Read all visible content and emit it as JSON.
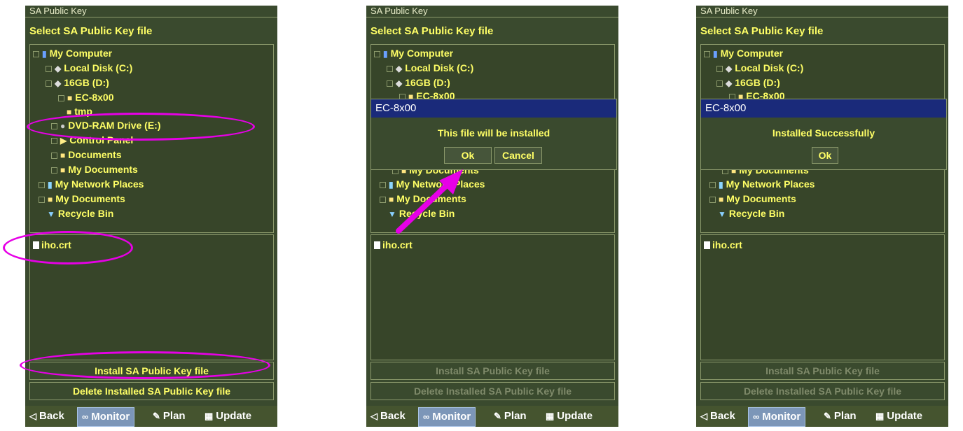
{
  "panel_title": "SA Public Key",
  "heading": "Select SA Public Key file",
  "tree": [
    {
      "label": "My Computer",
      "icon": "computer-icon"
    },
    {
      "label": "Local Disk (C:)",
      "icon": "disk-icon"
    },
    {
      "label": "16GB (D:)",
      "icon": "disk-icon"
    },
    {
      "label": "EC-8x00",
      "icon": "folder-icon"
    },
    {
      "label": "tmp",
      "icon": "folder-icon"
    },
    {
      "label": "DVD-RAM Drive (E:)",
      "icon": "dvd-icon"
    },
    {
      "label": "Control Panel",
      "icon": "control-panel-icon"
    },
    {
      "label": "Documents",
      "icon": "folder-icon"
    },
    {
      "label": "My Documents",
      "icon": "folder-icon"
    },
    {
      "label": "My Network Places",
      "icon": "network-icon"
    },
    {
      "label": "My Documents",
      "icon": "folder-icon"
    },
    {
      "label": "Recycle Bin",
      "icon": "recycle-bin-icon"
    }
  ],
  "file": "iho.crt",
  "buttons": {
    "install": "Install SA Public Key file",
    "delete": "Delete Installed SA Public Key file"
  },
  "bottom_bar": {
    "back": "Back",
    "monitor": "Monitor",
    "plan": "Plan",
    "update": "Update"
  },
  "dialog_install": {
    "title": "EC-8x00",
    "message": "This file will be installed",
    "ok": "Ok",
    "cancel": "Cancel"
  },
  "dialog_success": {
    "title": "EC-8x00",
    "message": "Installed Successfully",
    "ok": "Ok"
  },
  "colors": {
    "panel_bg": "#3a4a2e",
    "text_yellow": "#ffff66",
    "dialog_title_bg": "#1a2a7a",
    "highlight_magenta": "#e600e6"
  }
}
